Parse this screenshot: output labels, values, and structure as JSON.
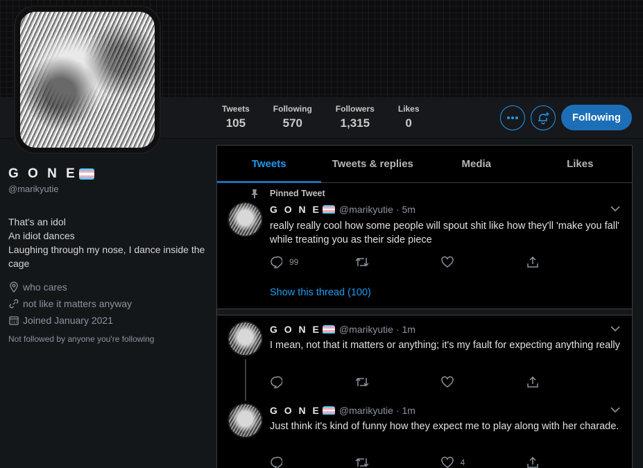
{
  "profile": {
    "name": "G O N E",
    "handle": "@marikyutie",
    "bio_lines": [
      "That's an idol",
      "An idiot dances",
      "Laughing through my nose, I dance inside the cage"
    ],
    "location": "who cares",
    "website": "not like it matters anyway",
    "joined": "Joined January 2021",
    "not_followed": "Not followed by anyone you're following"
  },
  "stats": [
    {
      "label": "Tweets",
      "value": "105"
    },
    {
      "label": "Following",
      "value": "570"
    },
    {
      "label": "Followers",
      "value": "1,315"
    },
    {
      "label": "Likes",
      "value": "0"
    }
  ],
  "buttons": {
    "more_icon": "more-dots-icon",
    "notify_icon": "bell-plus-icon",
    "following_label": "Following"
  },
  "tabs": [
    "Tweets",
    "Tweets & replies",
    "Media",
    "Likes"
  ],
  "tweets": [
    {
      "pinned_label": "Pinned Tweet",
      "name": "G O N E",
      "handle": "@marikyutie",
      "time": "· 5m",
      "text": "really really cool how some people will spout shit like how they'll 'make you fall' while treating you as their side piece",
      "reply_count": "99",
      "retweet_count": "",
      "like_count": "",
      "show_thread": "Show this thread (100)"
    },
    {
      "name": "G O N E",
      "handle": "@marikyutie",
      "time": "· 1m",
      "text": "I mean, not that it matters or anything; it's my fault for expecting anything really",
      "reply_count": "",
      "retweet_count": "",
      "like_count": ""
    },
    {
      "name": "G O N E",
      "handle": "@marikyutie",
      "time": "· 1m",
      "text": "Just think it's kind of funny how they expect me to play along with her charade.",
      "reply_count": "",
      "retweet_count": "",
      "like_count": "4"
    }
  ],
  "colors": {
    "accent": "#1d9bf0",
    "follow_button": "#1c6fb7",
    "background": "#000000",
    "panel": "#14171a"
  }
}
